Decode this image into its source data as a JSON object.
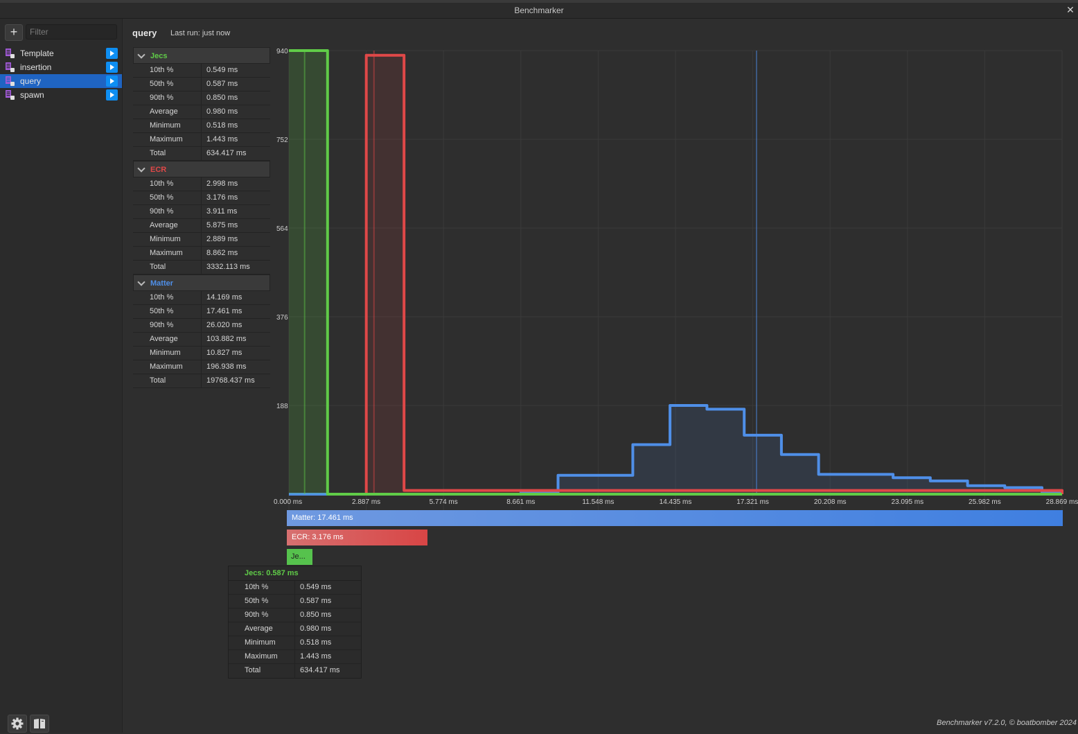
{
  "window": {
    "title": "Benchmarker",
    "close_glyph": "✕"
  },
  "sidebar": {
    "add_glyph": "+",
    "filter_placeholder": "Filter",
    "items": [
      {
        "label": "Template",
        "icon": "benchmark-file-icon",
        "selected": false
      },
      {
        "label": "insertion",
        "icon": "benchmark-file-icon",
        "selected": false
      },
      {
        "label": "query",
        "icon": "benchmark-file-icon",
        "selected": true
      },
      {
        "label": "spawn",
        "icon": "benchmark-file-icon",
        "selected": false
      }
    ]
  },
  "header": {
    "title": "query",
    "last_run": "Last run: just now"
  },
  "stat_groups": [
    {
      "name": "Jecs",
      "color": "#60cc48",
      "rows": [
        {
          "k": "10th %",
          "v": "0.549 ms"
        },
        {
          "k": "50th %",
          "v": "0.587 ms"
        },
        {
          "k": "90th %",
          "v": "0.850 ms"
        },
        {
          "k": "Average",
          "v": "0.980 ms"
        },
        {
          "k": "Minimum",
          "v": "0.518 ms"
        },
        {
          "k": "Maximum",
          "v": "1.443 ms"
        },
        {
          "k": "Total",
          "v": "634.417 ms"
        }
      ]
    },
    {
      "name": "ECR",
      "color": "#e04848",
      "rows": [
        {
          "k": "10th %",
          "v": "2.998 ms"
        },
        {
          "k": "50th %",
          "v": "3.176 ms"
        },
        {
          "k": "90th %",
          "v": "3.911 ms"
        },
        {
          "k": "Average",
          "v": "5.875 ms"
        },
        {
          "k": "Minimum",
          "v": "2.889 ms"
        },
        {
          "k": "Maximum",
          "v": "8.862 ms"
        },
        {
          "k": "Total",
          "v": "3332.113 ms"
        }
      ]
    },
    {
      "name": "Matter",
      "color": "#4f8fe8",
      "rows": [
        {
          "k": "10th %",
          "v": "14.169 ms"
        },
        {
          "k": "50th %",
          "v": "17.461 ms"
        },
        {
          "k": "90th %",
          "v": "26.020 ms"
        },
        {
          "k": "Average",
          "v": "103.882 ms"
        },
        {
          "k": "Minimum",
          "v": "10.827 ms"
        },
        {
          "k": "Maximum",
          "v": "196.938 ms"
        },
        {
          "k": "Total",
          "v": "19768.437 ms"
        }
      ]
    }
  ],
  "chart_data": {
    "type": "line",
    "xlim": [
      0,
      28.869
    ],
    "ylim": [
      0,
      940
    ],
    "x_ticks": [
      "0.000 ms",
      "2.887 ms",
      "5.774 ms",
      "8.661 ms",
      "11.548 ms",
      "14.435 ms",
      "17.321 ms",
      "20.208 ms",
      "23.095 ms",
      "25.982 ms",
      "28.869 ms"
    ],
    "y_ticks": [
      "940",
      "752",
      "564",
      "376",
      "188"
    ],
    "y_tick_values": [
      940,
      752,
      564,
      376,
      188
    ],
    "grid": true,
    "series": [
      {
        "name": "Jecs",
        "color": "#60cc48",
        "median": 0.587,
        "bin_edges": [
          0.0,
          1.443,
          28.869
        ],
        "counts": [
          940,
          0
        ]
      },
      {
        "name": "ECR",
        "color": "#e04848",
        "median": 3.176,
        "bin_edges": [
          1.443,
          2.889,
          4.3,
          28.869
        ],
        "counts": [
          0,
          930,
          8,
          0
        ]
      },
      {
        "name": "Matter",
        "color": "#4f8fe8",
        "median": 17.461,
        "bin_edges": [
          8.661,
          10.05,
          11.45,
          12.84,
          14.23,
          15.61,
          17.0,
          18.39,
          19.78,
          21.17,
          22.56,
          23.95,
          25.34,
          26.73,
          28.12
        ],
        "counts": [
          2,
          4,
          40,
          40,
          105,
          188,
          180,
          125,
          84,
          42,
          42,
          35,
          28,
          18,
          14,
          4
        ]
      }
    ]
  },
  "medians_bars": [
    {
      "name": "Matter",
      "label": "Matter: 17.461 ms"
    },
    {
      "name": "ECR",
      "label": "ECR: 3.176 ms"
    },
    {
      "name": "Jecs",
      "label": "Je..."
    }
  ],
  "tooltip": {
    "title": "Jecs: 0.587 ms",
    "rows": [
      {
        "k": "10th %",
        "v": "0.549 ms"
      },
      {
        "k": "50th %",
        "v": "0.587 ms"
      },
      {
        "k": "90th %",
        "v": "0.850 ms"
      },
      {
        "k": "Average",
        "v": "0.980 ms"
      },
      {
        "k": "Minimum",
        "v": "0.518 ms"
      },
      {
        "k": "Maximum",
        "v": "1.443 ms"
      },
      {
        "k": "Total",
        "v": "634.417 ms"
      }
    ]
  },
  "footer": {
    "credit": "Benchmarker v7.2.0, © boatbomber 2024",
    "icons": [
      "settings-gear-icon",
      "manual-book-icon"
    ]
  }
}
